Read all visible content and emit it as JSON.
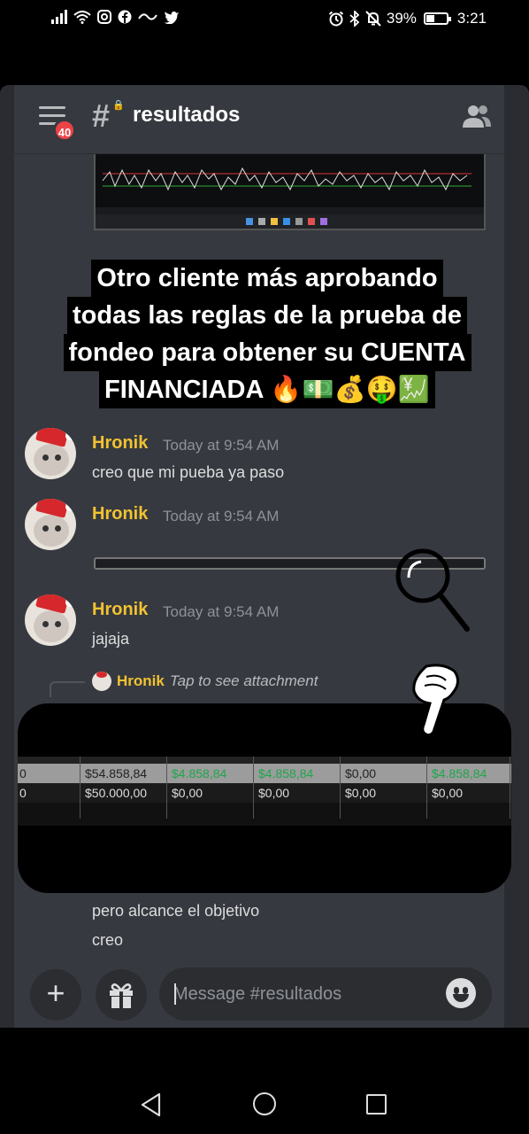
{
  "status_bar": {
    "battery": "39%",
    "time": "3:21",
    "left_icons": [
      "signal-icon",
      "wifi-icon",
      "instagram-icon",
      "facebook-icon",
      "app-icon",
      "twitter-icon"
    ],
    "right_icons": [
      "alarm-icon",
      "bluetooth-icon",
      "mute-icon",
      "battery-icon"
    ]
  },
  "header": {
    "badge_count": "40",
    "hash": "#",
    "channel_name": "resultados"
  },
  "caption": {
    "lines": [
      "Otro cliente más aprobando",
      "todas las reglas de la prueba de",
      "fondeo para obtener su CUENTA",
      "FINANCIADA 🔥💵💰🤑💹"
    ]
  },
  "messages": [
    {
      "author": "Hronik",
      "timestamp": "Today at 9:54 AM",
      "text": "creo que mi pueba ya paso"
    },
    {
      "author": "Hronik",
      "timestamp": "Today at 9:54 AM",
      "text": ""
    },
    {
      "author": "Hronik",
      "timestamp": "Today at 9:54 AM",
      "text": "jajaja"
    }
  ],
  "reply": {
    "author": "Hronik",
    "text": "Tap to see attachment"
  },
  "table": {
    "row1": [
      "0",
      "$54.858,84",
      "$4.858,84",
      "$4.858,84",
      "$0,00",
      "$4.858,84"
    ],
    "row2": [
      "0",
      "$50.000,00",
      "$0,00",
      "$0,00",
      "$0,00",
      "$0,00"
    ]
  },
  "continued_messages": [
    "pero alcance el objetivo",
    "creo"
  ],
  "composer": {
    "placeholder": "Message #resultados"
  },
  "colors": {
    "background": "#36393f",
    "author": "#f1c232",
    "badge": "#ed4245",
    "positive": "#1ea64a"
  }
}
